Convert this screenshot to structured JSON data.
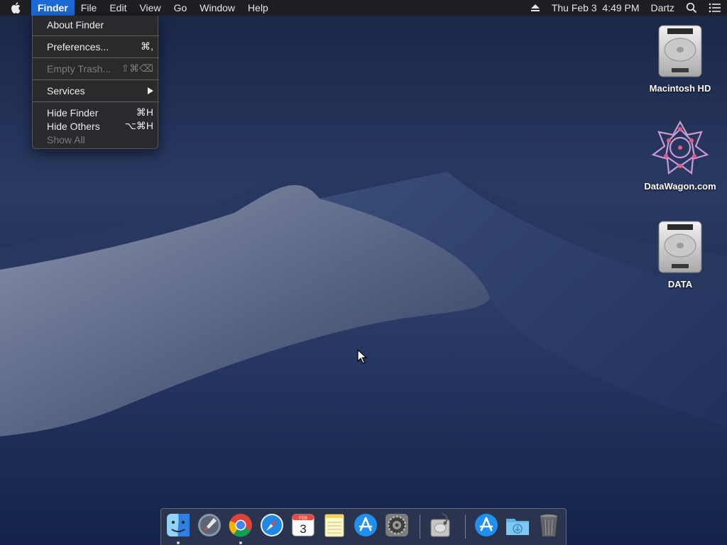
{
  "menubar": {
    "app": "Finder",
    "menus": [
      "File",
      "Edit",
      "View",
      "Go",
      "Window",
      "Help"
    ],
    "datetime": "Thu Feb 3  4:49 PM",
    "user": "Dartz",
    "icons": [
      "apple-icon",
      "eject-icon",
      "spotlight-search-icon",
      "notification-center-icon"
    ]
  },
  "finder_menu": {
    "about": "About Finder",
    "preferences": {
      "label": "Preferences...",
      "shortcut": "⌘,"
    },
    "empty_trash": {
      "label": "Empty Trash...",
      "shortcut": "⇧⌘⌫"
    },
    "services": "Services",
    "hide_finder": {
      "label": "Hide Finder",
      "shortcut": "⌘H"
    },
    "hide_others": {
      "label": "Hide Others",
      "shortcut": "⌥⌘H"
    },
    "show_all": "Show All"
  },
  "desktop_icons": [
    {
      "label": "Macintosh HD",
      "icon": "hard-drive-icon"
    },
    {
      "label": "DataWagon.com",
      "icon": "datawagon-logo-icon"
    },
    {
      "label": "DATA",
      "icon": "hard-drive-icon"
    }
  ],
  "dock": {
    "items": [
      {
        "name": "Finder",
        "icon": "finder-icon",
        "running": true
      },
      {
        "name": "Launchpad",
        "icon": "launchpad-icon",
        "running": false
      },
      {
        "name": "Google Chrome",
        "icon": "chrome-icon",
        "running": true
      },
      {
        "name": "Safari",
        "icon": "safari-icon",
        "running": false
      },
      {
        "name": "Calendar",
        "icon": "calendar-icon",
        "running": false,
        "month": "FEB",
        "day": "3"
      },
      {
        "name": "Notes",
        "icon": "notes-icon",
        "running": false
      },
      {
        "name": "App Store",
        "icon": "app-store-icon",
        "running": false
      },
      {
        "name": "System Preferences",
        "icon": "system-preferences-icon",
        "running": false
      },
      {
        "name": "Disk Utility",
        "icon": "disk-utility-icon",
        "running": false
      },
      {
        "name": "Applications",
        "icon": "applications-folder-icon",
        "running": false
      },
      {
        "name": "Downloads",
        "icon": "downloads-folder-icon",
        "running": false
      },
      {
        "name": "Trash",
        "icon": "trash-icon",
        "running": false
      }
    ]
  },
  "colors": {
    "menu_highlight": "#1b6ad6",
    "menubar_bg": "#1e1e20",
    "sky": "#1a2a4f"
  }
}
